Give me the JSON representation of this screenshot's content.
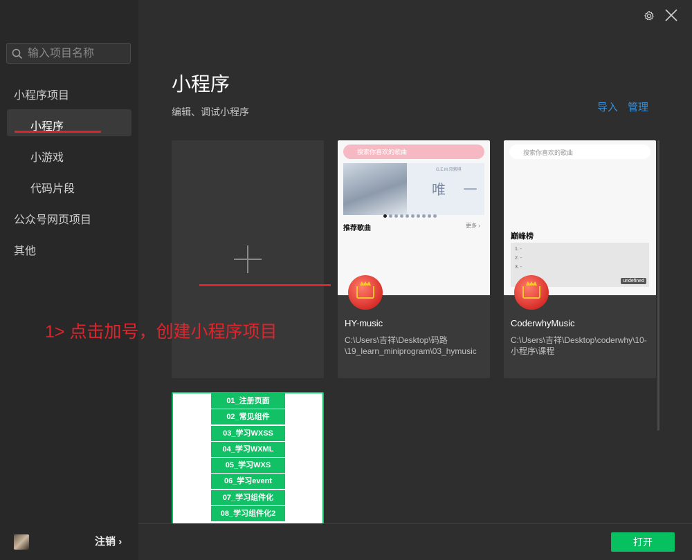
{
  "sidebar": {
    "search_placeholder": "输入项目名称",
    "sections": {
      "miniprogram_project": "小程序项目",
      "miniprogram": "小程序",
      "minigame": "小游戏",
      "code_snippet": "代码片段",
      "official_account_web": "公众号网页项目",
      "other": "其他"
    },
    "logout_label": "注销",
    "logout_arrow": "›"
  },
  "main": {
    "title": "小程序",
    "subtitle": "编辑、调试小程序",
    "import_label": "导入",
    "manage_label": "管理",
    "open_button": "打开"
  },
  "projects": [
    {
      "name": "HY-music",
      "path": "C:\\Users\\吉祥\\Desktop\\码路\\19_learn_miniprogram\\03_hymusic",
      "preview": {
        "search_text": "搜索你喜欢的歌曲",
        "banner_title": "唯 一",
        "banner_small": "G.E.M.邓紫棋",
        "section_title": "推荐歌曲",
        "section_more": "更多 ›"
      }
    },
    {
      "name": "CoderwhyMusic",
      "path": "C:\\Users\\吉祥\\Desktop\\coderwhy\\10-小程序\\课程",
      "preview": {
        "search_text": "搜索你喜欢的歌曲",
        "section_title": "巅峰榜",
        "rank_lines": [
          "1. -",
          "2. -",
          "3. -"
        ],
        "badge": "undefined"
      }
    }
  ],
  "list_project": {
    "items": [
      "01_注册页面",
      "02_常见组件",
      "03_学习WXSS",
      "04_学习WXML",
      "05_学习WXS",
      "06_学习event",
      "07_学习组件化",
      "08_学习组件化2"
    ]
  },
  "annotation": {
    "text": "1> 点击加号，创建小程序项目"
  },
  "colors": {
    "accent_green": "#07c160",
    "link_blue": "#3d8fd6",
    "annotation_red": "#e0242b"
  },
  "icons": [
    "search-icon",
    "gear-icon",
    "close-icon",
    "plus-icon",
    "cart-icon"
  ]
}
